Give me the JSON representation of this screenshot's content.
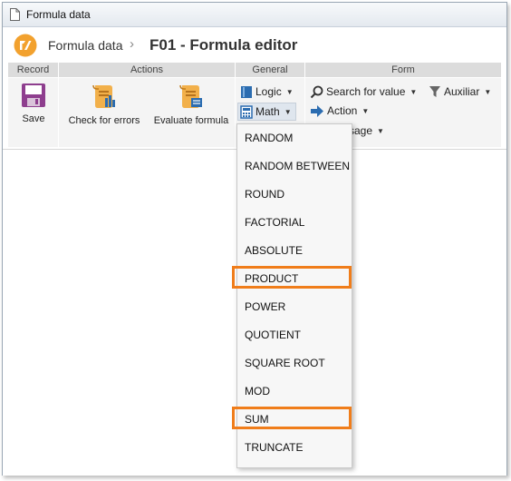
{
  "window": {
    "title": "Formula data"
  },
  "header": {
    "app_name": "Formula data",
    "separator": "›",
    "page_title": "F01 - Formula editor"
  },
  "ribbon": {
    "groups": {
      "record": "Record",
      "actions": "Actions",
      "general": "General",
      "form": "Form"
    },
    "save": "Save",
    "check_errors": "Check for errors",
    "evaluate": "Evaluate formula",
    "logic": "Logic",
    "math": "Math",
    "search_for_value": "Search for value",
    "auxiliar": "Auxiliar",
    "action": "Action",
    "message_partial": "sage"
  },
  "math_menu": {
    "items": [
      "RANDOM",
      "RANDOM BETWEEN",
      "ROUND",
      "FACTORIAL",
      "ABSOLUTE",
      "PRODUCT",
      "POWER",
      "QUOTIENT",
      "SQUARE ROOT",
      "MOD",
      "SUM",
      "TRUNCATE"
    ],
    "highlighted": [
      "PRODUCT",
      "SUM"
    ]
  },
  "colors": {
    "highlight": "#f07d1a",
    "logo": "#f2a12e",
    "save_icon": "#8e3e8e",
    "accent_blue": "#2b6cb0"
  },
  "icons": {
    "save": "floppy-disk-icon",
    "check": "scroll-check-icon",
    "evaluate": "scroll-evaluate-icon",
    "logic": "book-icon",
    "math": "calculator-icon",
    "search": "magnifier-icon",
    "auxiliar": "filter-icon",
    "action": "arrow-right-icon"
  }
}
